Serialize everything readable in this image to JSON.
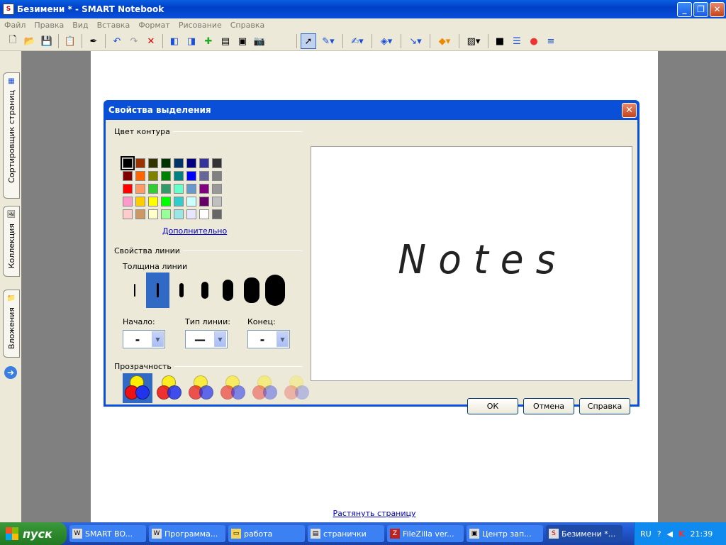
{
  "window": {
    "title": "Безимени * - SMART Notebook",
    "icon": "smart-notebook-icon"
  },
  "menu": [
    "Файл",
    "Правка",
    "Вид",
    "Вставка",
    "Формат",
    "Рисование",
    "Справка"
  ],
  "sidebar": {
    "tabs": [
      "Сортировщик страниц",
      "Коллекция",
      "Вложения"
    ]
  },
  "page": {
    "stretch_link": "Растянуть страницу"
  },
  "dialog": {
    "title": "Свойства выделения",
    "outline_color_label": "Цвет контура",
    "more_colors": "Дополнительно",
    "line_props_label": "Свойства линии",
    "line_width_label": "Толщина линии",
    "start_label": "Начало:",
    "line_type_label": "Тип линии:",
    "end_label": "Конец:",
    "start_value": "-",
    "line_type_value": "—",
    "end_value": "-",
    "transparency_label": "Прозрачность",
    "ok": "ОК",
    "cancel": "Отмена",
    "help": "Справка",
    "preview_text": "Notes",
    "palette": [
      "#000000",
      "#993300",
      "#333300",
      "#003300",
      "#003366",
      "#000080",
      "#333399",
      "#333333",
      "#800000",
      "#FF6600",
      "#808000",
      "#008000",
      "#008080",
      "#0000FF",
      "#666699",
      "#808080",
      "#FF0000",
      "#FF9966",
      "#33CC33",
      "#339966",
      "#66FFCC",
      "#6699CC",
      "#800080",
      "#999999",
      "#FF99CC",
      "#FFCC00",
      "#FFFF00",
      "#00FF00",
      "#33CCCC",
      "#CCFFFF",
      "#660066",
      "#C0C0C0",
      "#FFCCCC",
      "#CC9966",
      "#FFFFCC",
      "#99FF99",
      "#99E6E6",
      "#E6E6FF",
      "#FFFFFF",
      "#666666"
    ]
  },
  "taskbar": {
    "start": "пуск",
    "tasks": [
      "SMART BO...",
      "Программа...",
      "работа",
      "странички",
      "FileZilla ver...",
      "Центр зап...",
      "Безимени *..."
    ],
    "lang": "RU",
    "clock": "21:39"
  }
}
